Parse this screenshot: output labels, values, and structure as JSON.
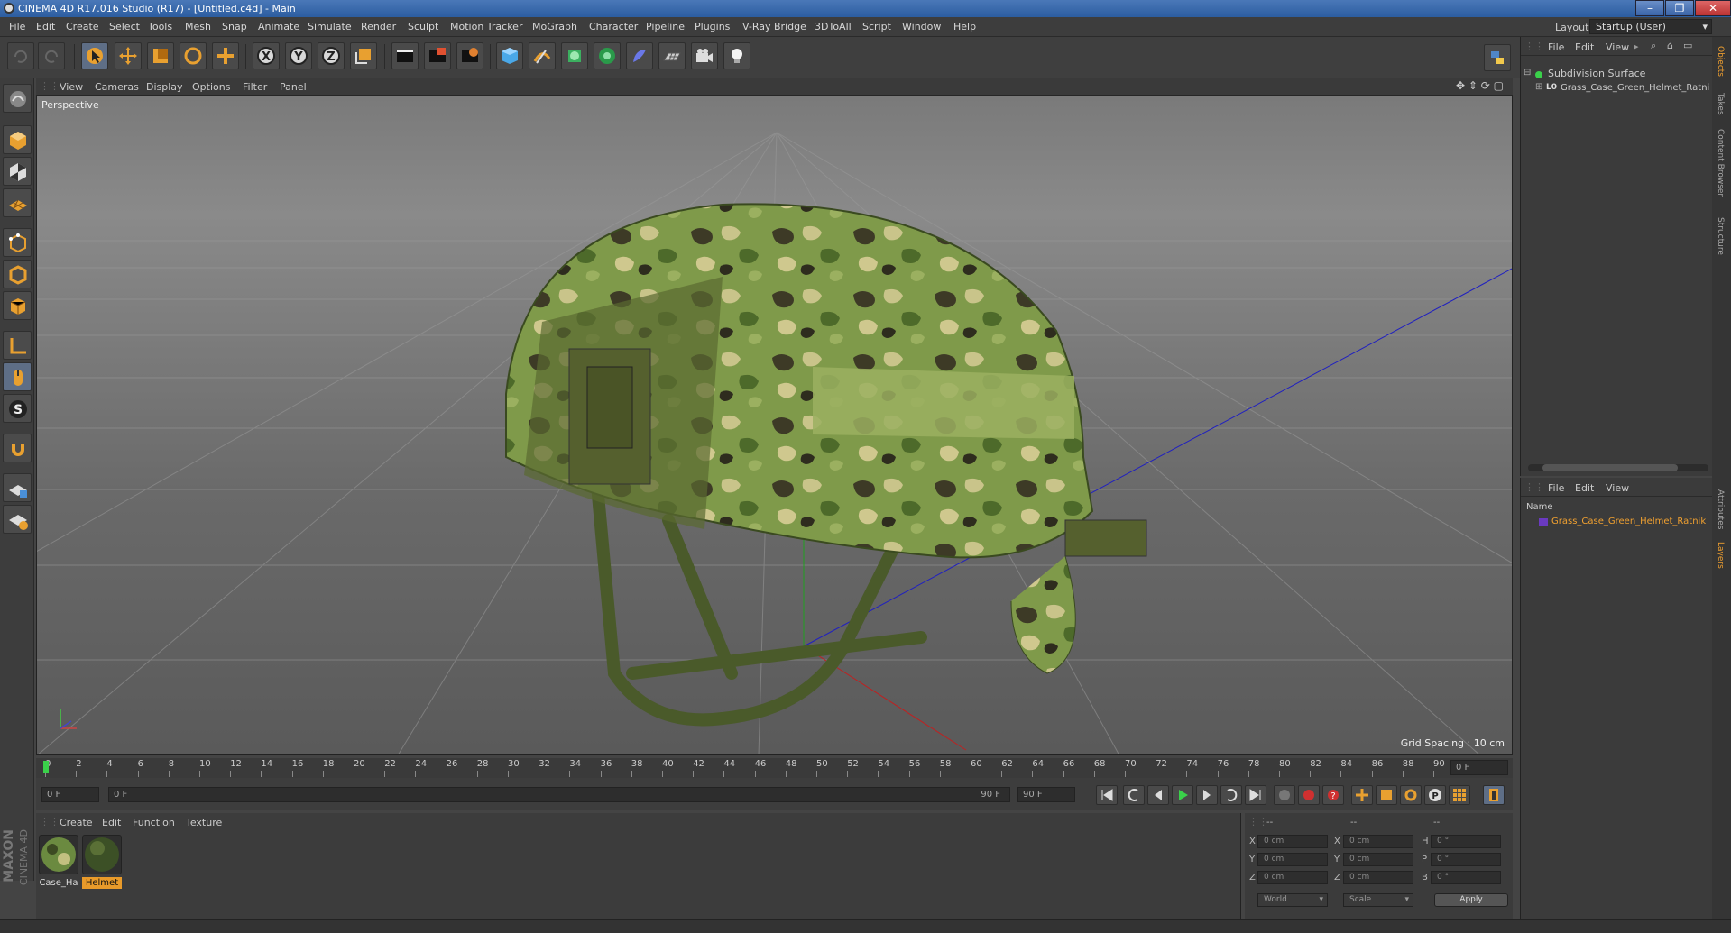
{
  "window": {
    "title": "CINEMA 4D R17.016 Studio (R17) - [Untitled.c4d] - Main",
    "buttons": [
      "–",
      "❐",
      "✕"
    ]
  },
  "menu": {
    "items": [
      "File",
      "Edit",
      "Create",
      "Select",
      "Tools",
      "Mesh",
      "Snap",
      "Animate",
      "Simulate",
      "Render",
      "Sculpt",
      "Motion Tracker",
      "MoGraph",
      "Character",
      "Pipeline",
      "Plugins",
      "V-Ray Bridge",
      "3DToAll",
      "Script",
      "Window",
      "Help"
    ],
    "layout_label": "Layout:",
    "layout_value": "Startup (User)"
  },
  "toolbar": {
    "icons": [
      "undo-icon",
      "redo-icon",
      "select-arrow-icon",
      "move-icon",
      "scale-icon",
      "rotate-icon",
      "live-select-icon",
      "x-axis-icon",
      "y-axis-icon",
      "z-axis-icon",
      "world-coord-icon",
      "render-view-icon",
      "render-picture-viewer-icon",
      "edit-render-settings-icon",
      "cube-icon",
      "pen-spline-icon",
      "subdivision-icon",
      "cloner-icon",
      "deformer-icon",
      "floor-icon",
      "camera-icon",
      "light-icon"
    ],
    "axis_labels": [
      "X",
      "Y",
      "Z"
    ]
  },
  "left_toolbar": {
    "icons": [
      "make-editable-icon",
      "model-mode-icon",
      "texture-mode-icon",
      "workplane-icon",
      "points-mode-icon",
      "edges-mode-icon",
      "polygons-mode-icon",
      "axis-mode-icon",
      "tweak-icon",
      "snap-icon",
      "magnet-icon",
      "lock-grid-icon",
      "solo-icon"
    ]
  },
  "viewport": {
    "menu": [
      "View",
      "Cameras",
      "Display",
      "Options",
      "Filter",
      "Panel"
    ],
    "label": "Perspective",
    "grid_spacing": "Grid Spacing : 10 cm"
  },
  "timeline": {
    "ticks": [
      "0",
      "2",
      "4",
      "6",
      "8",
      "10",
      "12",
      "14",
      "16",
      "18",
      "20",
      "22",
      "24",
      "26",
      "28",
      "30",
      "32",
      "34",
      "36",
      "38",
      "40",
      "42",
      "44",
      "46",
      "48",
      "50",
      "52",
      "54",
      "56",
      "58",
      "60",
      "62",
      "64",
      "66",
      "68",
      "70",
      "72",
      "74",
      "76",
      "78",
      "80",
      "82",
      "84",
      "86",
      "88",
      "90"
    ],
    "current_frame": "0 F"
  },
  "transport": {
    "start": "0 F",
    "range_start": "0 F",
    "range_end": "90 F",
    "end": "90 F"
  },
  "material_manager": {
    "menu": [
      "Create",
      "Edit",
      "Function",
      "Texture"
    ],
    "materials": [
      {
        "label": "Case_Ha",
        "selected": false
      },
      {
        "label": "Helmet",
        "selected": true
      }
    ]
  },
  "coordinates": {
    "headers": [
      "--",
      "--",
      "--"
    ],
    "rows": [
      {
        "a": "X",
        "av": "0 cm",
        "b": "X",
        "bv": "0 cm",
        "c": "H",
        "cv": "0 °"
      },
      {
        "a": "Y",
        "av": "0 cm",
        "b": "Y",
        "bv": "0 cm",
        "c": "P",
        "cv": "0 °"
      },
      {
        "a": "Z",
        "av": "0 cm",
        "b": "Z",
        "bv": "0 cm",
        "c": "B",
        "cv": "0 °"
      }
    ],
    "world": "World",
    "scale": "Scale",
    "apply": "Apply"
  },
  "object_manager": {
    "menu": [
      "File",
      "Edit",
      "View"
    ],
    "objects": [
      "Subdivision Surface",
      "Grass_Case_Green_Helmet_Ratni"
    ]
  },
  "layer_manager": {
    "menu": [
      "File",
      "Edit",
      "View"
    ],
    "column": "Name",
    "layers": [
      "Grass_Case_Green_Helmet_Ratnik"
    ]
  },
  "side_tabs": [
    "Objects",
    "Takes",
    "Content Browser",
    "Structure",
    "Attributes",
    "Layers"
  ],
  "branding": {
    "maxon": "MAXON",
    "c4d": "CINEMA 4D"
  },
  "colors": {
    "accent": "#f0a030",
    "selected_bg": "#e89a2a",
    "layer_text": "#f0a030",
    "title_bar": "#3a6aae"
  }
}
